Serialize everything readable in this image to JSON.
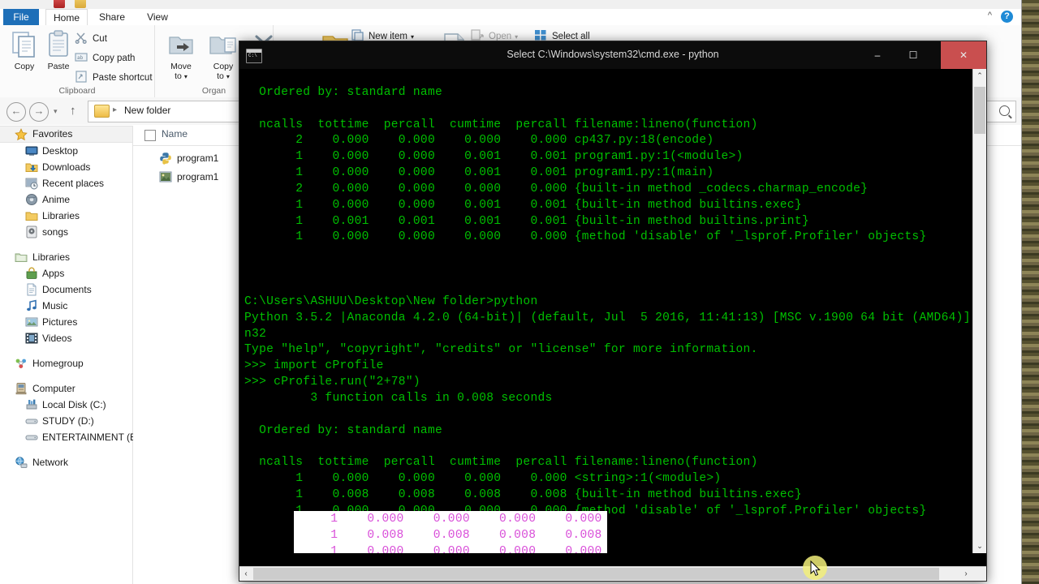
{
  "explorer": {
    "tabs": [
      {
        "id": "file",
        "label": "File"
      },
      {
        "id": "home",
        "label": "Home"
      },
      {
        "id": "share",
        "label": "Share"
      },
      {
        "id": "view",
        "label": "View"
      }
    ],
    "help_label": "?",
    "ribbon": {
      "groups": [
        {
          "id": "clipboard",
          "label": "Clipboard"
        },
        {
          "id": "organize",
          "label": "Organ"
        }
      ],
      "copy_label": "Copy",
      "paste_label": "Paste",
      "cut_label": "Cut",
      "copy_path_label": "Copy path",
      "paste_shortcut_label": "Paste shortcut",
      "move_to_label": "Move\nto",
      "copy_to_label": "Copy\nto",
      "new_item_label": "New item",
      "open_label": "Open",
      "select_all_label": "Select all"
    },
    "address": {
      "breadcrumb": "New folder",
      "separator": "▸",
      "back_glyph": "←",
      "forward_glyph": "→",
      "up_glyph": "↑",
      "history_glyph": "▾",
      "search_placeholder": ""
    },
    "nav_pane": {
      "sections": [
        {
          "id": "favorites",
          "root": {
            "label": "Favorites",
            "icon": "star-icon"
          },
          "items": [
            {
              "label": "Desktop",
              "icon": "desktop-icon"
            },
            {
              "label": "Downloads",
              "icon": "downloads-icon"
            },
            {
              "label": "Recent places",
              "icon": "recent-places-icon"
            },
            {
              "label": "Anime",
              "icon": "anime-folder-icon"
            },
            {
              "label": "Libraries",
              "icon": "folder-icon"
            },
            {
              "label": "songs",
              "icon": "songs-icon"
            }
          ]
        },
        {
          "id": "libraries",
          "root": {
            "label": "Libraries",
            "icon": "libraries-icon"
          },
          "items": [
            {
              "label": "Apps",
              "icon": "apps-icon"
            },
            {
              "label": "Documents",
              "icon": "documents-icon"
            },
            {
              "label": "Music",
              "icon": "music-icon"
            },
            {
              "label": "Pictures",
              "icon": "pictures-icon"
            },
            {
              "label": "Videos",
              "icon": "videos-icon"
            }
          ]
        },
        {
          "id": "homegroup",
          "root": {
            "label": "Homegroup",
            "icon": "homegroup-icon"
          },
          "items": []
        },
        {
          "id": "computer",
          "root": {
            "label": "Computer",
            "icon": "computer-icon"
          },
          "items": [
            {
              "label": "Local Disk (C:)",
              "icon": "hard-disk-icon"
            },
            {
              "label": "STUDY (D:)",
              "icon": "drive-icon"
            },
            {
              "label": "ENTERTAINMENT (E:)",
              "icon": "drive-icon"
            }
          ]
        },
        {
          "id": "network",
          "root": {
            "label": "Network",
            "icon": "network-icon"
          },
          "items": []
        }
      ]
    },
    "file_list": {
      "column_header": "Name",
      "items": [
        {
          "label": "program1",
          "icon": "python-file-icon"
        },
        {
          "label": "program1",
          "icon": "image-file-icon"
        }
      ]
    }
  },
  "console": {
    "title": "Select C:\\Windows\\system32\\cmd.exe - python",
    "window_buttons": {
      "minimize": "–",
      "maximize": "☐",
      "close": "✕"
    },
    "colors": {
      "foreground": "#00c000",
      "background": "#000000",
      "selection_bg": "#ffffff",
      "selection_fg": "#d94fd9"
    },
    "lines": [
      "",
      "  Ordered by: standard name",
      "",
      "  ncalls  tottime  percall  cumtime  percall filename:lineno(function)",
      "       2    0.000    0.000    0.000    0.000 cp437.py:18(encode)",
      "       1    0.000    0.000    0.001    0.001 program1.py:1(<module>)",
      "       1    0.000    0.000    0.001    0.001 program1.py:1(main)",
      "       2    0.000    0.000    0.000    0.000 {built-in method _codecs.charmap_encode}",
      "       1    0.000    0.000    0.001    0.001 {built-in method builtins.exec}",
      "       1    0.001    0.001    0.001    0.001 {built-in method builtins.print}",
      "       1    0.000    0.000    0.000    0.000 {method 'disable' of '_lsprof.Profiler' objects}",
      "",
      "",
      "",
      "C:\\Users\\ASHUU\\Desktop\\New folder>python",
      "Python 3.5.2 |Anaconda 4.2.0 (64-bit)| (default, Jul  5 2016, 11:41:13) [MSC v.1900 64 bit (AMD64)]",
      "n32",
      "Type \"help\", \"copyright\", \"credits\" or \"license\" for more information.",
      ">>> import cProfile",
      ">>> cProfile.run(\"2+78\")",
      "         3 function calls in 0.008 seconds",
      "",
      "  Ordered by: standard name",
      "",
      "  ncalls  tottime  percall  cumtime  percall filename:lineno(function)",
      "       1    0.000    0.000    0.000    0.000 <string>:1(<module>)",
      "       1    0.008    0.008    0.008    0.008 {built-in method builtins.exec}",
      "       1    0.000    0.000    0.000    0.000 {method 'disable' of '_lsprof.Profiler' objects}",
      "",
      "",
      ">>>"
    ],
    "selection": {
      "lines": [
        "     1    0.000    0.000    0.000    0.000 ",
        "     1    0.008    0.008    0.008    0.008 ",
        "     1    0.000    0.000    0.000    0.000 "
      ]
    },
    "scrollbars": {
      "v_up": "⌃",
      "v_down": "⌄",
      "h_left": "‹",
      "h_right": "›"
    }
  }
}
